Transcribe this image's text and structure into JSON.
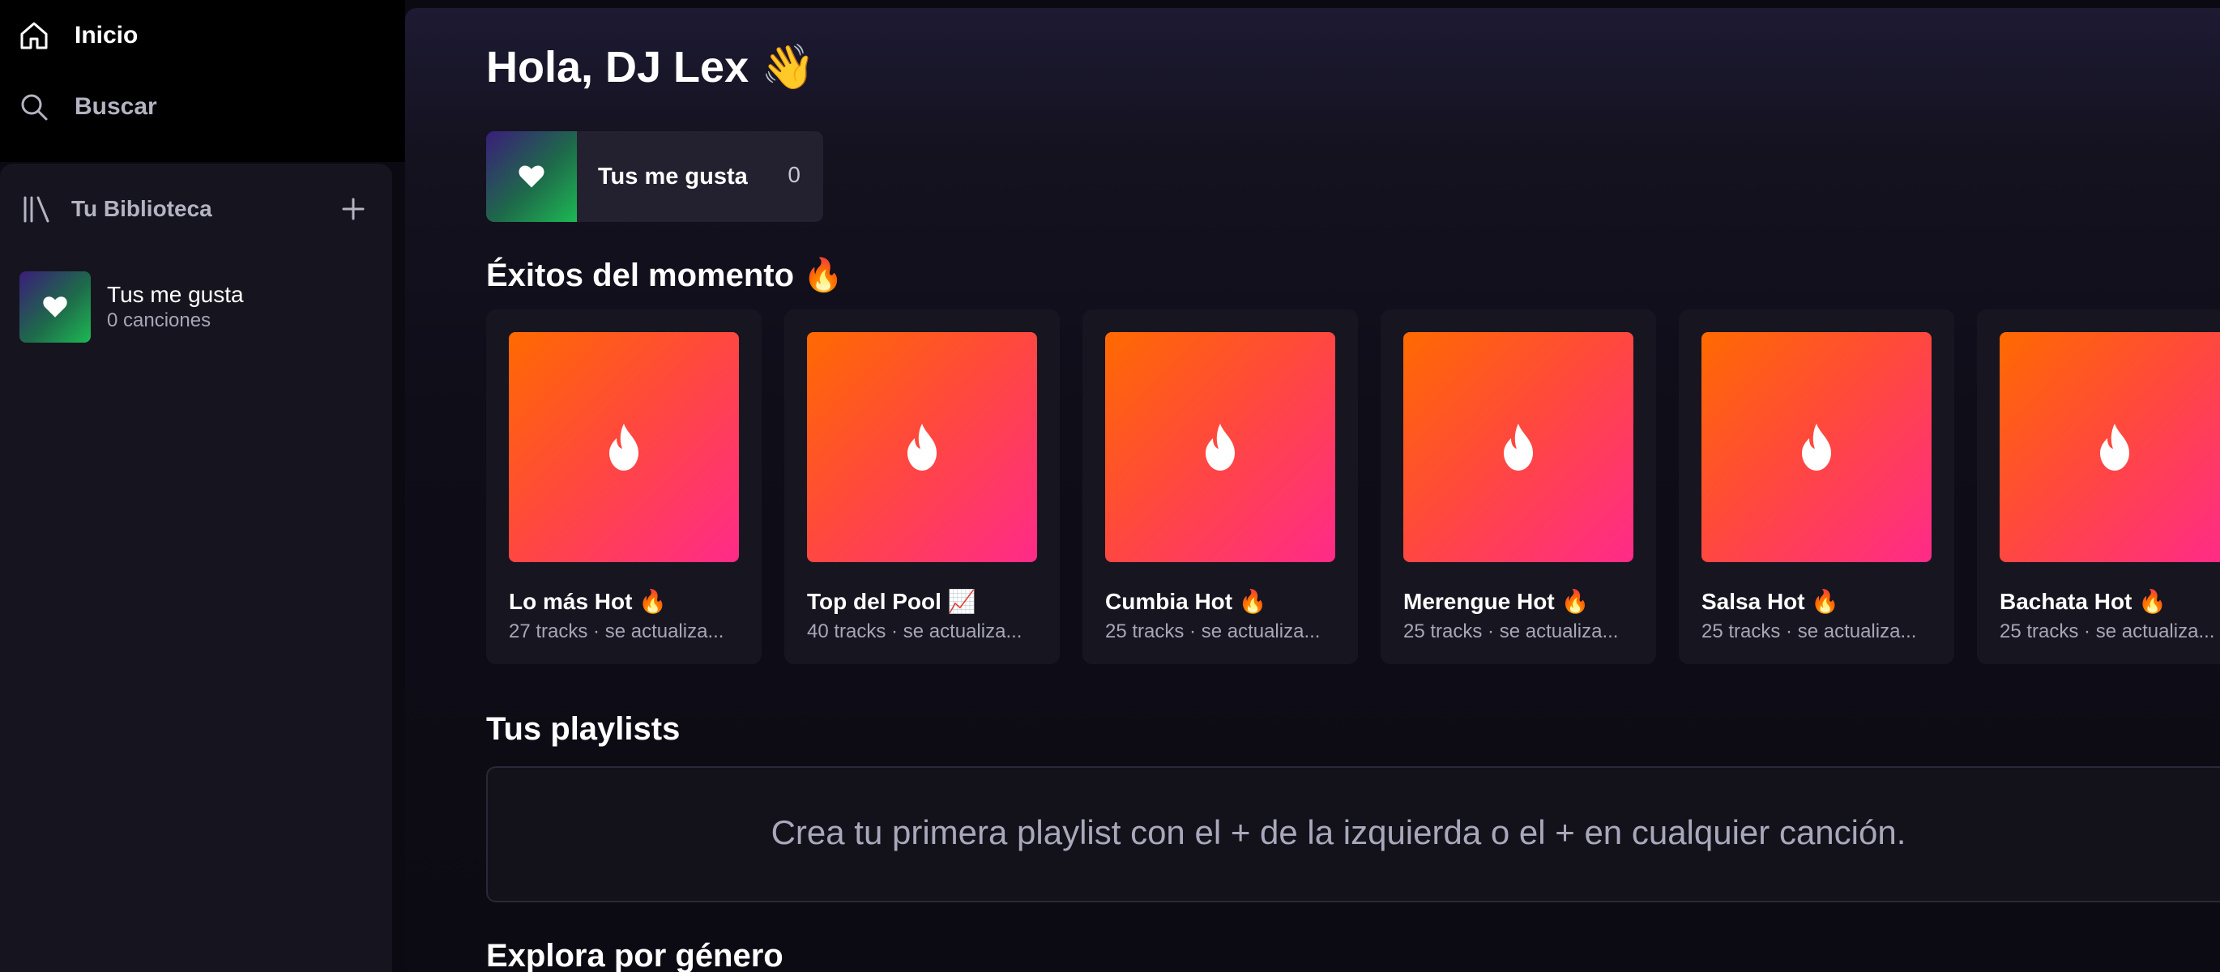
{
  "nav": {
    "home_label": "Inicio",
    "search_label": "Buscar"
  },
  "library": {
    "title": "Tu Biblioteca",
    "items": [
      {
        "title": "Tus me gusta",
        "subtitle": "0 canciones"
      }
    ]
  },
  "main": {
    "greeting": "Hola, DJ Lex 👋",
    "liked": {
      "label": "Tus me gusta",
      "count": "0"
    },
    "hits_title": "Éxitos del momento 🔥",
    "hits": [
      {
        "title": "Lo más Hot 🔥",
        "subtitle": "27 tracks · se actualiza..."
      },
      {
        "title": "Top del Pool 📈",
        "subtitle": "40 tracks · se actualiza..."
      },
      {
        "title": "Cumbia Hot 🔥",
        "subtitle": "25 tracks · se actualiza..."
      },
      {
        "title": "Merengue Hot 🔥",
        "subtitle": "25 tracks · se actualiza..."
      },
      {
        "title": "Salsa Hot 🔥",
        "subtitle": "25 tracks · se actualiza..."
      },
      {
        "title": "Bachata Hot 🔥",
        "subtitle": "25 tracks · se actualiza..."
      }
    ],
    "playlists_title": "Tus playlists",
    "playlists_empty": "Crea tu primera playlist con el + de la izquierda o el + en cualquier canción.",
    "explore_title": "Explora por género"
  },
  "icons": {
    "home": "home-icon",
    "search": "search-icon",
    "library": "library-icon",
    "add": "plus-icon",
    "heart": "heart-icon",
    "flame": "flame-icon"
  },
  "colors": {
    "accent_green": "#1db954",
    "hot_gradient_start": "#ff6a00",
    "hot_gradient_end": "#ff2a8a"
  }
}
